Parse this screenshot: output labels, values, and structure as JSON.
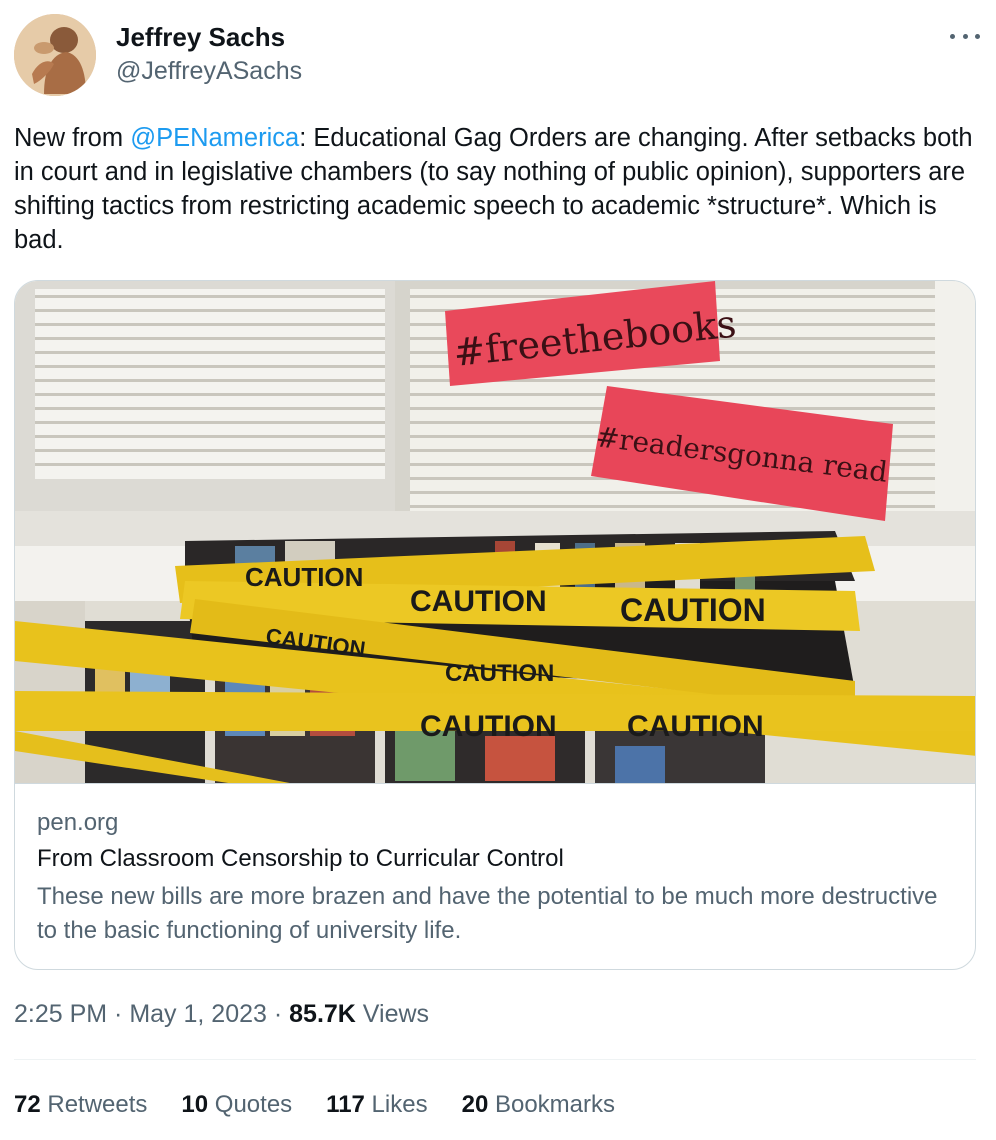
{
  "author": {
    "name": "Jeffrey Sachs",
    "handle": "@JeffreyASachs"
  },
  "tweet": {
    "text_before": "New from ",
    "mention": "@PENamerica",
    "text_after": ": Educational Gag Orders are changing. After setbacks both in court and in legislative chambers (to say nothing of public opinion), supporters are shifting tactics from restricting academic speech to academic *structure*. Which is bad."
  },
  "card": {
    "image_signs": [
      "#freethebooks",
      "#readersgonna read"
    ],
    "image_tape_text": "CAUTION",
    "domain": "pen.org",
    "title": "From Classroom Censorship to Curricular Control",
    "description": "These new bills are more brazen and have the potential to be much more destructive to the basic functioning of university life."
  },
  "meta": {
    "time": "2:25 PM",
    "sep1": " · ",
    "date": "May 1, 2023",
    "sep2": " · ",
    "views_count": "85.7K",
    "views_label": " Views"
  },
  "stats": {
    "retweets_count": "72",
    "retweets_label": " Retweets",
    "quotes_count": "10",
    "quotes_label": " Quotes",
    "likes_count": "117",
    "likes_label": " Likes",
    "bookmarks_count": "20",
    "bookmarks_label": " Bookmarks"
  },
  "colors": {
    "link": "#1d9bf0",
    "secondary_text": "#536471",
    "primary_text": "#0f1419",
    "border": "#cfd9de",
    "caution_yellow": "#e8c21c",
    "sign_red": "#e8495a"
  }
}
